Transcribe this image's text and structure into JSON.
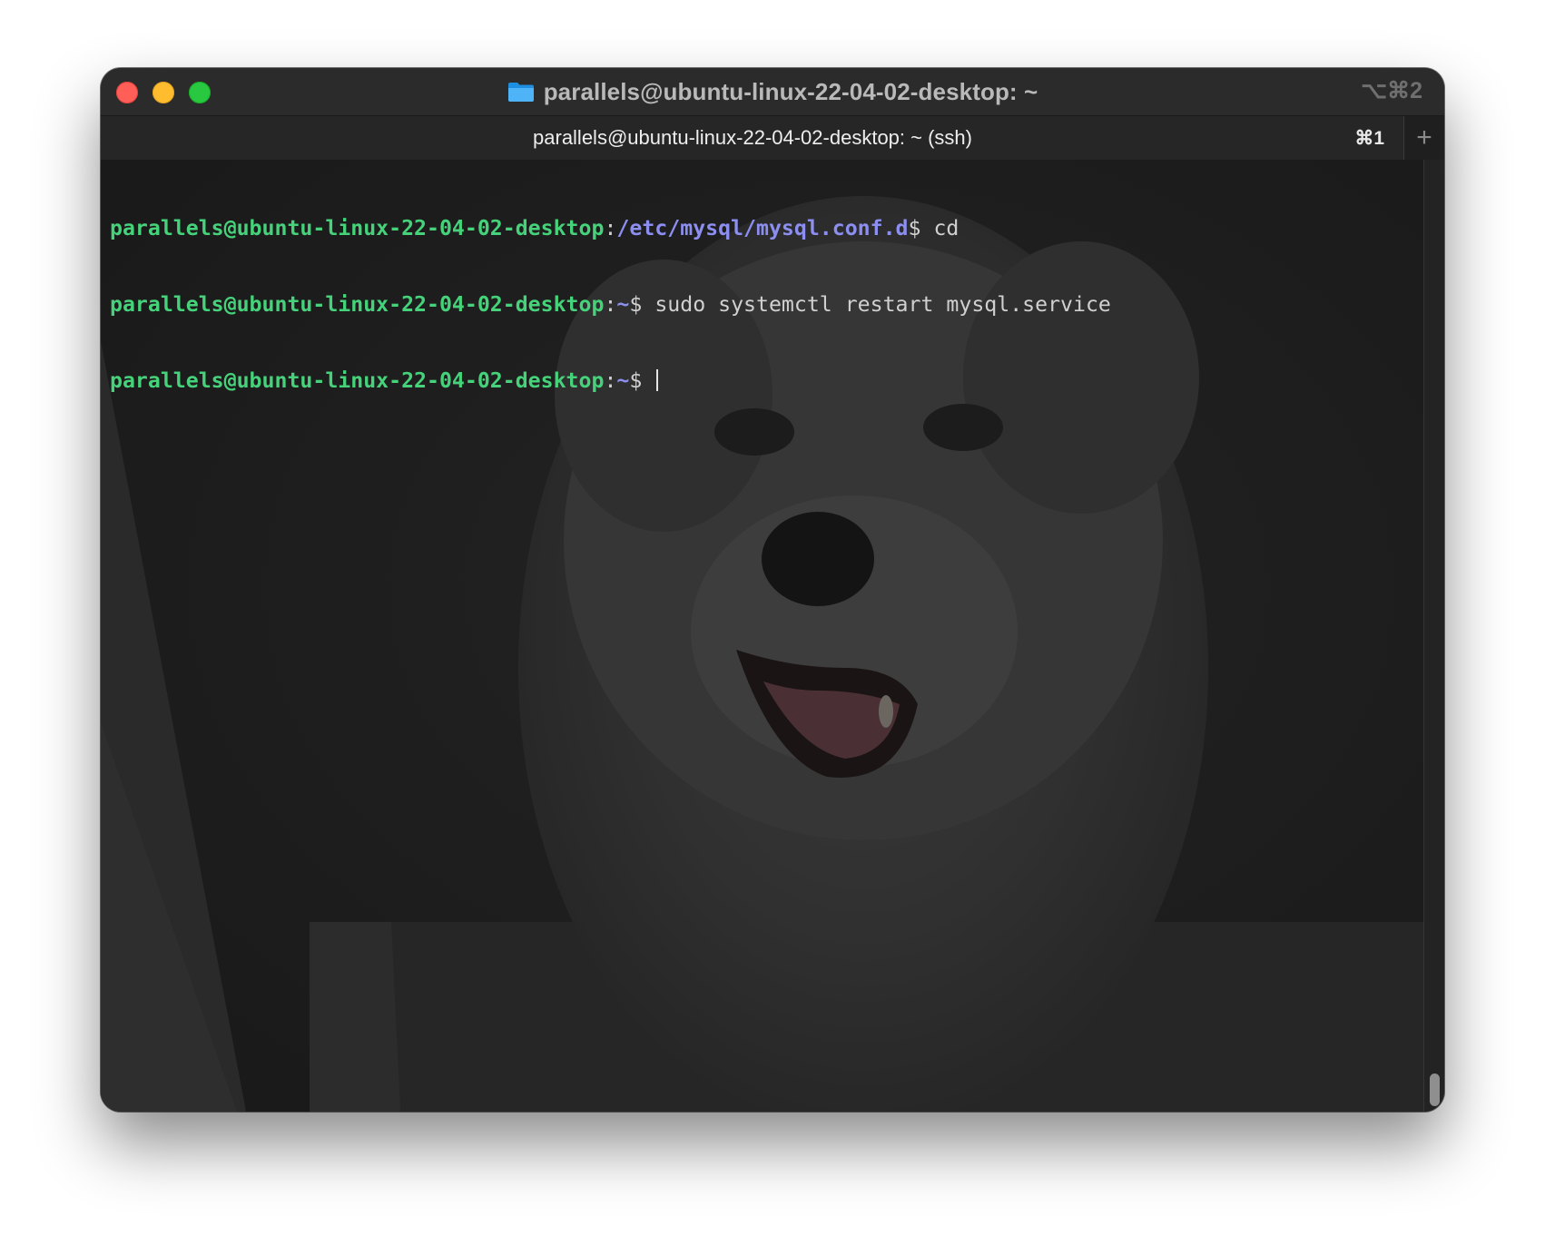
{
  "window": {
    "title": "parallels@ubuntu-linux-22-04-02-desktop: ~",
    "shortcut": "⌥⌘2",
    "folder_icon": "folder-icon"
  },
  "tabs": [
    {
      "label": "parallels@ubuntu-linux-22-04-02-desktop: ~ (ssh)",
      "shortcut": "⌘1"
    }
  ],
  "new_tab_label": "+",
  "colors": {
    "user_host": "#46d27a",
    "path": "#8c8ff0",
    "command": "#d0d0d0"
  },
  "terminal": {
    "lines": [
      {
        "user": "parallels@ubuntu-linux-22-04-02-desktop",
        "sep": ":",
        "path": "/etc/mysql/mysql.conf.d",
        "prompt": "$ ",
        "command": "cd"
      },
      {
        "user": "parallels@ubuntu-linux-22-04-02-desktop",
        "sep": ":",
        "path": "~",
        "prompt": "$ ",
        "command": "sudo systemctl restart mysql.service"
      },
      {
        "user": "parallels@ubuntu-linux-22-04-02-desktop",
        "sep": ":",
        "path": "~",
        "prompt": "$ ",
        "command": ""
      }
    ]
  }
}
